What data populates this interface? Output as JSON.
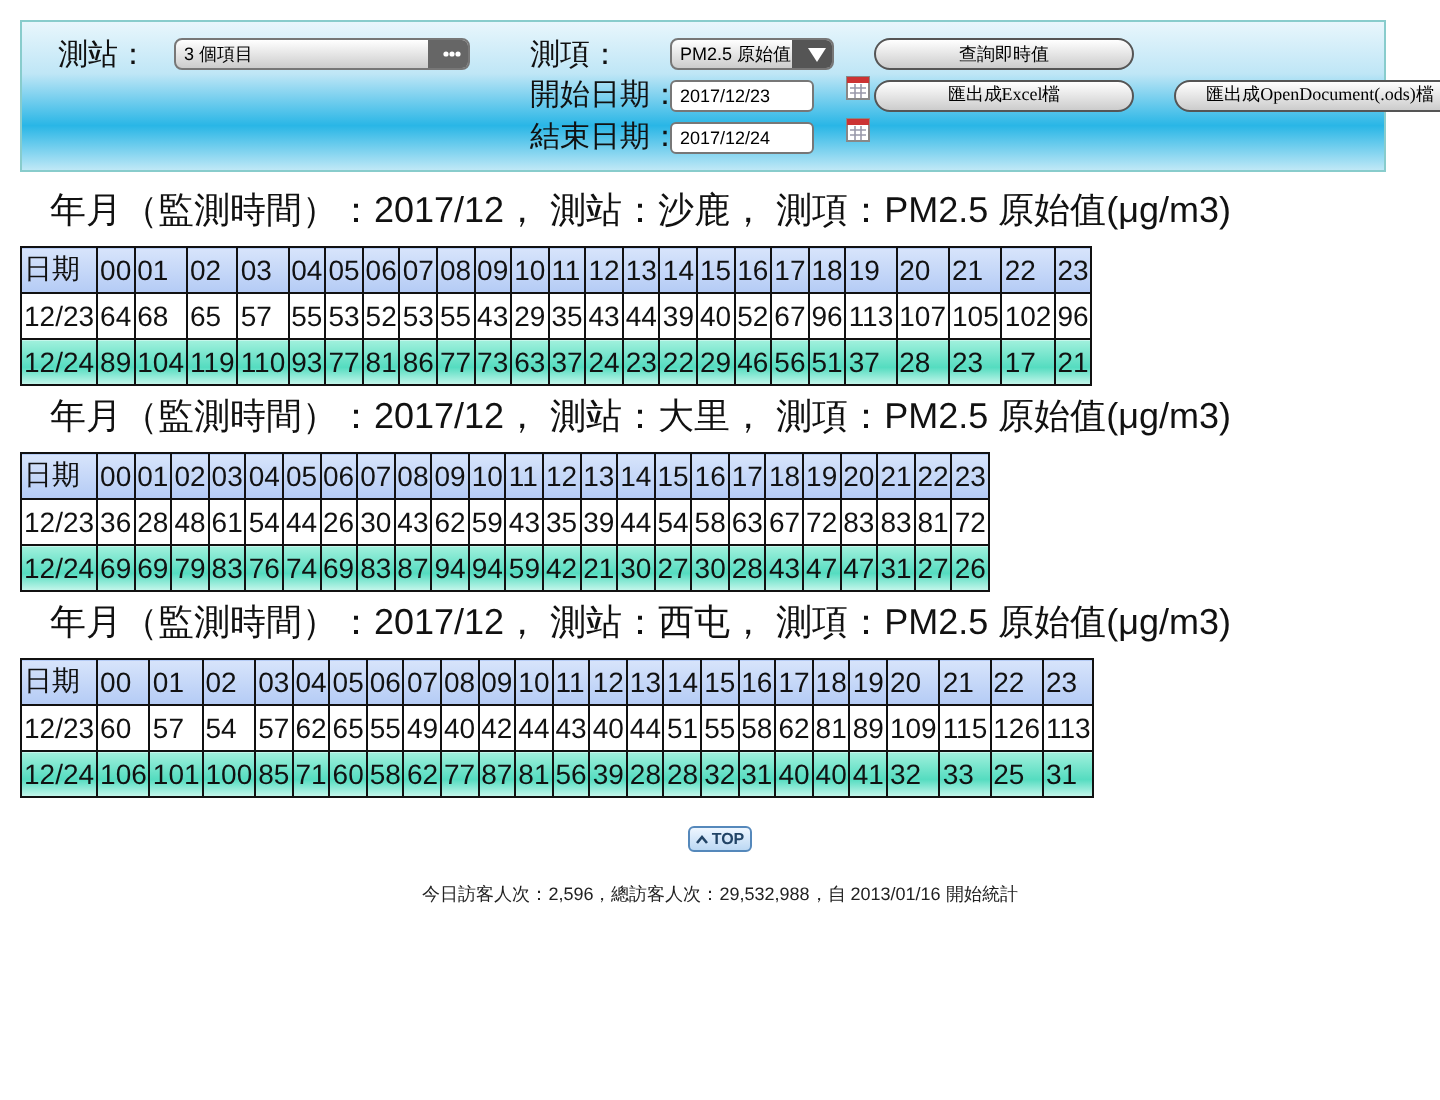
{
  "filters": {
    "station_label": "測站：",
    "station_value": "3 個項目",
    "item_label": "測項：",
    "item_value": "PM2.5 原始值",
    "start_label": "開始日期：",
    "start_value": "2017/12/23",
    "end_label": "結束日期：",
    "end_value": "2017/12/24"
  },
  "buttons": [
    "查詢即時值",
    "匯出成Excel檔",
    "匯出成OpenDocument(.ods)檔"
  ],
  "sections": [
    {
      "heading": "年月（監測時間）：2017/12， 測站：沙鹿， 測項：PM2.5 原始值(μg/m3)",
      "columns": [
        "日期",
        "00",
        "01",
        "02",
        "03",
        "04",
        "05",
        "06",
        "07",
        "08",
        "09",
        "10",
        "11",
        "12",
        "13",
        "14",
        "15",
        "16",
        "17",
        "18",
        "19",
        "20",
        "21",
        "22",
        "23"
      ],
      "rows": [
        [
          "12/23",
          "64",
          "68",
          "65",
          "57",
          "55",
          "53",
          "52",
          "53",
          "55",
          "43",
          "29",
          "35",
          "43",
          "44",
          "39",
          "40",
          "52",
          "67",
          "96",
          "113",
          "107",
          "105",
          "102",
          "96"
        ],
        [
          "12/24",
          "89",
          "104",
          "119",
          "110",
          "93",
          "77",
          "81",
          "86",
          "77",
          "73",
          "63",
          "37",
          "24",
          "23",
          "22",
          "29",
          "46",
          "56",
          "51",
          "37",
          "28",
          "23",
          "17",
          "21"
        ]
      ]
    },
    {
      "heading": "年月（監測時間）：2017/12， 測站：大里， 測項：PM2.5 原始值(μg/m3)",
      "columns": [
        "日期",
        "00",
        "01",
        "02",
        "03",
        "04",
        "05",
        "06",
        "07",
        "08",
        "09",
        "10",
        "11",
        "12",
        "13",
        "14",
        "15",
        "16",
        "17",
        "18",
        "19",
        "20",
        "21",
        "22",
        "23"
      ],
      "rows": [
        [
          "12/23",
          "36",
          "28",
          "48",
          "61",
          "54",
          "44",
          "26",
          "30",
          "43",
          "62",
          "59",
          "43",
          "35",
          "39",
          "44",
          "54",
          "58",
          "63",
          "67",
          "72",
          "83",
          "83",
          "81",
          "72"
        ],
        [
          "12/24",
          "69",
          "69",
          "79",
          "83",
          "76",
          "74",
          "69",
          "83",
          "87",
          "94",
          "94",
          "59",
          "42",
          "21",
          "30",
          "27",
          "30",
          "28",
          "43",
          "47",
          "47",
          "31",
          "27",
          "26"
        ]
      ]
    },
    {
      "heading": "年月（監測時間）：2017/12， 測站：西屯， 測項：PM2.5 原始值(μg/m3)",
      "columns": [
        "日期",
        "00",
        "01",
        "02",
        "03",
        "04",
        "05",
        "06",
        "07",
        "08",
        "09",
        "10",
        "11",
        "12",
        "13",
        "14",
        "15",
        "16",
        "17",
        "18",
        "19",
        "20",
        "21",
        "22",
        "23"
      ],
      "rows": [
        [
          "12/23",
          "60",
          "57",
          "54",
          "57",
          "62",
          "65",
          "55",
          "49",
          "40",
          "42",
          "44",
          "43",
          "40",
          "44",
          "51",
          "55",
          "58",
          "62",
          "81",
          "89",
          "109",
          "115",
          "126",
          "113"
        ],
        [
          "12/24",
          "106",
          "101",
          "100",
          "85",
          "71",
          "60",
          "58",
          "62",
          "77",
          "87",
          "81",
          "56",
          "39",
          "28",
          "28",
          "32",
          "31",
          "40",
          "40",
          "41",
          "32",
          "33",
          "25",
          "31"
        ]
      ]
    }
  ],
  "top_link": "TOP",
  "footer": "今日訪客人次：2,596，總訪客人次：29,532,988，自 2013/01/16 開始統計"
}
